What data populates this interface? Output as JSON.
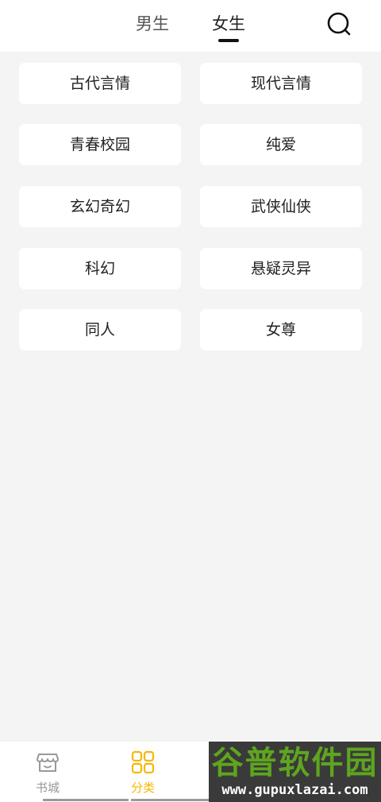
{
  "header": {
    "tabs": [
      {
        "label": "男生",
        "active": false
      },
      {
        "label": "女生",
        "active": true
      }
    ],
    "search_icon": "search-icon"
  },
  "categories": [
    {
      "label": "古代言情"
    },
    {
      "label": "现代言情"
    },
    {
      "label": "青春校园"
    },
    {
      "label": "纯爱"
    },
    {
      "label": "玄幻奇幻"
    },
    {
      "label": "武侠仙侠"
    },
    {
      "label": "科幻"
    },
    {
      "label": "悬疑灵异"
    },
    {
      "label": "同人"
    },
    {
      "label": "女尊"
    }
  ],
  "bottom_nav": {
    "items": [
      {
        "label": "书城",
        "icon": "bookstore-icon",
        "active": false
      },
      {
        "label": "分类",
        "icon": "category-grid-icon",
        "active": true
      }
    ]
  },
  "watermark": {
    "title": "谷普软件园",
    "url": "www.gupuxlazai.com"
  },
  "colors": {
    "accent": "#f5b800",
    "background": "#f4f4f4",
    "card": "#ffffff",
    "watermark_green": "#5ea51f"
  }
}
